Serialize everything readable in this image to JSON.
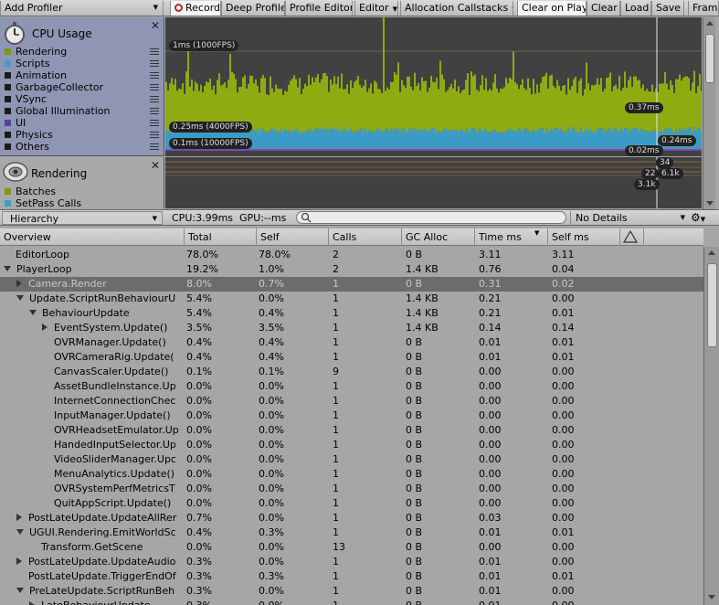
{
  "toolbar": {
    "add_profiler": "Add Profiler",
    "record": "Record",
    "deep_profile": "Deep Profile",
    "profile_editor": "Profile Editor",
    "editor": "Editor",
    "allocation_callstacks": "Allocation Callstacks",
    "clear_on_play": "Clear on Play",
    "clear": "Clear",
    "load": "Load",
    "save": "Save",
    "frame": "Fram"
  },
  "cpu_panel": {
    "title": "CPU Usage",
    "legend": [
      {
        "label": "Rendering",
        "color": "#7a9a12"
      },
      {
        "label": "Scripts",
        "color": "#3aa0c4"
      },
      {
        "label": "Animation",
        "color": "#1a1a1a"
      },
      {
        "label": "GarbageCollector",
        "color": "#1a1a1a"
      },
      {
        "label": "VSync",
        "color": "#1a1a1a"
      },
      {
        "label": "Global Illumination",
        "color": "#1a1a1a"
      },
      {
        "label": "UI",
        "color": "#5a3fa0"
      },
      {
        "label": "Physics",
        "color": "#1a1a1a"
      },
      {
        "label": "Others",
        "color": "#1a1a1a"
      }
    ],
    "chart_labels": {
      "fps1000": "1ms (1000FPS)",
      "fps4000": "0.25ms (4000FPS)",
      "fps10000": "0.1ms (10000FPS)",
      "sel_037": "0.37ms",
      "sel_024": "0.24ms",
      "sel_002": "0.02ms"
    },
    "colors": {
      "rendering": "#8fab12",
      "scripts": "#3a9cc6",
      "ui": "#7a49c0",
      "background": "#414141"
    }
  },
  "rendering_panel": {
    "title": "Rendering",
    "legend": [
      {
        "label": "Batches",
        "color": "#7a9a12"
      },
      {
        "label": "SetPass Calls",
        "color": "#3aa0c4"
      }
    ],
    "chart_labels": {
      "v34": "34",
      "v22": "22",
      "v6_1k": "6.1k",
      "v3_1k": "3.1k"
    }
  },
  "statusbar": {
    "view": "Hierarchy",
    "cpu": "CPU:3.99ms",
    "gpu": "GPU:--ms",
    "details": "No Details"
  },
  "table": {
    "headers": {
      "overview": "Overview",
      "total": "Total",
      "self": "Self",
      "calls": "Calls",
      "gc_alloc": "GC Alloc",
      "time_ms": "Time ms",
      "self_ms": "Self ms"
    },
    "rows": [
      {
        "name": "EditorLoop",
        "total": "78.0%",
        "self": "78.0%",
        "calls": "2",
        "gc": "0 B",
        "time": "3.11",
        "selfms": "3.11"
      },
      {
        "name": "PlayerLoop",
        "total": "19.2%",
        "self": "1.0%",
        "calls": "2",
        "gc": "1.4 KB",
        "time": "0.76",
        "selfms": "0.04"
      },
      {
        "name": "Camera.Render",
        "total": "8.0%",
        "self": "0.7%",
        "calls": "1",
        "gc": "0 B",
        "time": "0.31",
        "selfms": "0.02"
      },
      {
        "name": "Update.ScriptRunBehaviourU",
        "total": "5.4%",
        "self": "0.0%",
        "calls": "1",
        "gc": "1.4 KB",
        "time": "0.21",
        "selfms": "0.00"
      },
      {
        "name": "BehaviourUpdate",
        "total": "5.4%",
        "self": "0.4%",
        "calls": "1",
        "gc": "1.4 KB",
        "time": "0.21",
        "selfms": "0.01"
      },
      {
        "name": "EventSystem.Update()",
        "total": "3.5%",
        "self": "3.5%",
        "calls": "1",
        "gc": "1.4 KB",
        "time": "0.14",
        "selfms": "0.14"
      },
      {
        "name": "OVRManager.Update()",
        "total": "0.4%",
        "self": "0.4%",
        "calls": "1",
        "gc": "0 B",
        "time": "0.01",
        "selfms": "0.01"
      },
      {
        "name": "OVRCameraRig.Update(",
        "total": "0.4%",
        "self": "0.4%",
        "calls": "1",
        "gc": "0 B",
        "time": "0.01",
        "selfms": "0.01"
      },
      {
        "name": "CanvasScaler.Update()",
        "total": "0.1%",
        "self": "0.1%",
        "calls": "9",
        "gc": "0 B",
        "time": "0.00",
        "selfms": "0.00"
      },
      {
        "name": "AssetBundleInstance.Up",
        "total": "0.0%",
        "self": "0.0%",
        "calls": "1",
        "gc": "0 B",
        "time": "0.00",
        "selfms": "0.00"
      },
      {
        "name": "InternetConnectionChec",
        "total": "0.0%",
        "self": "0.0%",
        "calls": "1",
        "gc": "0 B",
        "time": "0.00",
        "selfms": "0.00"
      },
      {
        "name": "InputManager.Update()",
        "total": "0.0%",
        "self": "0.0%",
        "calls": "1",
        "gc": "0 B",
        "time": "0.00",
        "selfms": "0.00"
      },
      {
        "name": "OVRHeadsetEmulator.Up",
        "total": "0.0%",
        "self": "0.0%",
        "calls": "1",
        "gc": "0 B",
        "time": "0.00",
        "selfms": "0.00"
      },
      {
        "name": "HandedInputSelector.Up",
        "total": "0.0%",
        "self": "0.0%",
        "calls": "1",
        "gc": "0 B",
        "time": "0.00",
        "selfms": "0.00"
      },
      {
        "name": "VideoSliderManager.Upc",
        "total": "0.0%",
        "self": "0.0%",
        "calls": "1",
        "gc": "0 B",
        "time": "0.00",
        "selfms": "0.00"
      },
      {
        "name": "MenuAnalytics.Update()",
        "total": "0.0%",
        "self": "0.0%",
        "calls": "1",
        "gc": "0 B",
        "time": "0.00",
        "selfms": "0.00"
      },
      {
        "name": "OVRSystemPerfMetricsT",
        "total": "0.0%",
        "self": "0.0%",
        "calls": "1",
        "gc": "0 B",
        "time": "0.00",
        "selfms": "0.00"
      },
      {
        "name": "QuitAppScript.Update()",
        "total": "0.0%",
        "self": "0.0%",
        "calls": "1",
        "gc": "0 B",
        "time": "0.00",
        "selfms": "0.00"
      },
      {
        "name": "PostLateUpdate.UpdateAllRer",
        "total": "0.7%",
        "self": "0.0%",
        "calls": "1",
        "gc": "0 B",
        "time": "0.03",
        "selfms": "0.00"
      },
      {
        "name": "UGUI.Rendering.EmitWorldSc",
        "total": "0.4%",
        "self": "0.3%",
        "calls": "1",
        "gc": "0 B",
        "time": "0.01",
        "selfms": "0.01"
      },
      {
        "name": "Transform.GetScene",
        "total": "0.0%",
        "self": "0.0%",
        "calls": "13",
        "gc": "0 B",
        "time": "0.00",
        "selfms": "0.00"
      },
      {
        "name": "PostLateUpdate.UpdateAudio",
        "total": "0.3%",
        "self": "0.0%",
        "calls": "1",
        "gc": "0 B",
        "time": "0.01",
        "selfms": "0.00"
      },
      {
        "name": "PostLateUpdate.TriggerEndOf",
        "total": "0.3%",
        "self": "0.3%",
        "calls": "1",
        "gc": "0 B",
        "time": "0.01",
        "selfms": "0.01"
      },
      {
        "name": "PreLateUpdate.ScriptRunBeh",
        "total": "0.3%",
        "self": "0.0%",
        "calls": "1",
        "gc": "0 B",
        "time": "0.01",
        "selfms": "0.00"
      },
      {
        "name": "LateBehaviourUpdate",
        "total": "0.3%",
        "self": "0.0%",
        "calls": "1",
        "gc": "0 B",
        "time": "0.01",
        "selfms": "0.00"
      }
    ]
  }
}
